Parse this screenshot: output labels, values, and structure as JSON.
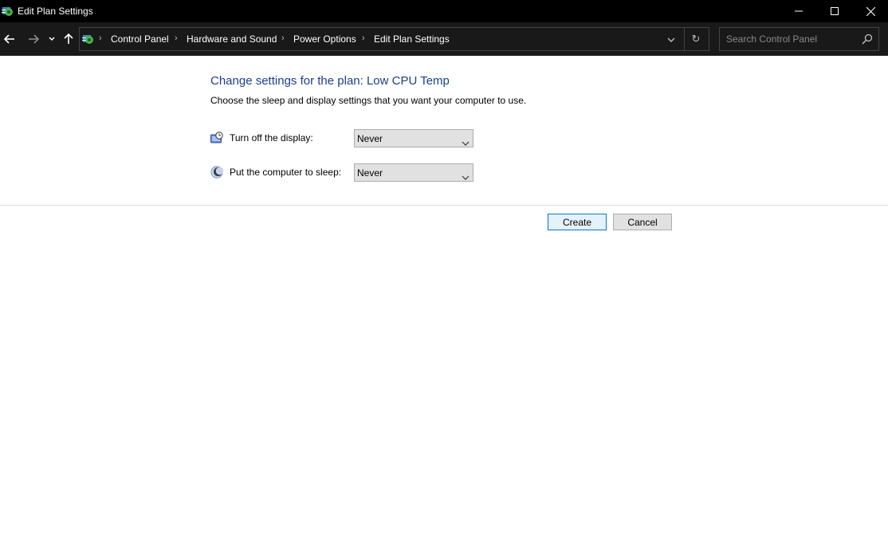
{
  "window": {
    "title": "Edit Plan Settings"
  },
  "nav": {
    "breadcrumbs": [
      "Control Panel",
      "Hardware and Sound",
      "Power Options",
      "Edit Plan Settings"
    ],
    "search_placeholder": "Search Control Panel"
  },
  "content": {
    "heading": "Change settings for the plan: Low CPU Temp",
    "subheading": "Choose the sleep and display settings that you want your computer to use.",
    "settings": [
      {
        "label": "Turn off the display:",
        "value": "Never",
        "icon": "display-clock-icon"
      },
      {
        "label": "Put the computer to sleep:",
        "value": "Never",
        "icon": "moon-icon"
      }
    ]
  },
  "buttons": {
    "create": "Create",
    "cancel": "Cancel"
  },
  "colors": {
    "titlebar": "#000000",
    "navbar": "#191919",
    "heading": "#1e3d8f",
    "primary_button_border": "#0078d7"
  }
}
